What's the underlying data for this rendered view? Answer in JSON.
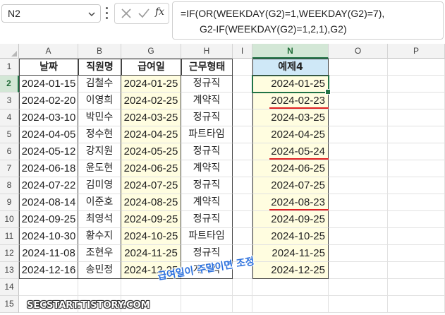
{
  "formula_bar": {
    "name_box": "N2",
    "formula_line1": "=IF(OR(WEEKDAY(G2)=1,WEEKDAY(G2)=7),",
    "formula_line2": "G2-IF(WEEKDAY(G2)=1,2,1),G2)",
    "fx_label": "fx"
  },
  "columns": [
    "A",
    "B",
    "G",
    "H",
    "I",
    "N",
    "O",
    "P"
  ],
  "rows": [
    "1",
    "2",
    "3",
    "4",
    "5",
    "6",
    "7",
    "8",
    "9",
    "10",
    "11",
    "12",
    "13",
    "14",
    "15"
  ],
  "headers": {
    "a": "날짜",
    "b": "직원명",
    "g": "급여일",
    "h": "근무형태",
    "n": "예제4"
  },
  "data": [
    {
      "a": "2024-01-15",
      "b": "김철수",
      "g": "2024-01-25",
      "h": "정규직",
      "n": "2024-01-25"
    },
    {
      "a": "2024-02-20",
      "b": "이영희",
      "g": "2024-02-25",
      "h": "계약직",
      "n": "2024-02-23"
    },
    {
      "a": "2024-03-10",
      "b": "박민수",
      "g": "2024-03-25",
      "h": "정규직",
      "n": "2024-03-25"
    },
    {
      "a": "2024-04-05",
      "b": "정수현",
      "g": "2024-04-25",
      "h": "파트타임",
      "n": "2024-04-25"
    },
    {
      "a": "2024-05-12",
      "b": "강지원",
      "g": "2024-05-25",
      "h": "정규직",
      "n": "2024-05-24"
    },
    {
      "a": "2024-06-18",
      "b": "윤도현",
      "g": "2024-06-25",
      "h": "계약직",
      "n": "2024-06-25"
    },
    {
      "a": "2024-07-22",
      "b": "김미영",
      "g": "2024-07-25",
      "h": "정규직",
      "n": "2024-07-25"
    },
    {
      "a": "2024-08-14",
      "b": "이준호",
      "g": "2024-08-25",
      "h": "계약직",
      "n": "2024-08-23"
    },
    {
      "a": "2024-09-25",
      "b": "최영석",
      "g": "2024-09-25",
      "h": "정규직",
      "n": "2024-09-25"
    },
    {
      "a": "2024-10-30",
      "b": "황수지",
      "g": "2024-10-25",
      "h": "파트타임",
      "n": "2024-10-25"
    },
    {
      "a": "2024-11-08",
      "b": "조현우",
      "g": "2024-11-25",
      "h": "정규직",
      "n": "2024-11-25"
    },
    {
      "a": "2024-12-16",
      "b": "송민정",
      "g": "2024-12-25",
      "h": "계약직",
      "n": "2024-12-25"
    }
  ],
  "annotation": "급여일이 주말이면 조정",
  "watermark": "SECSTART.TISTORY.COM",
  "colors": {
    "accent": "#217346",
    "yellow_fill": "#fffde0",
    "header_blue": "#cfe8f7",
    "underline_red": "#e02020",
    "annotation_blue": "#2a6fdc"
  }
}
